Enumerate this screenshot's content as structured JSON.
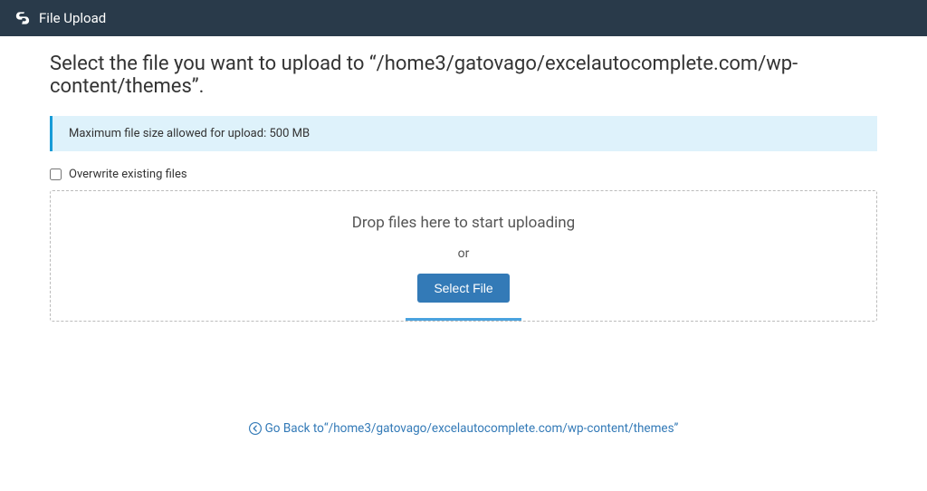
{
  "header": {
    "title": "File Upload"
  },
  "page": {
    "title_prefix": "Select the file you want to upload to ",
    "title_path": "“/home3/gatovago/excelautocomplete.com/wp-content/themes”."
  },
  "notice": {
    "text": "Maximum file size allowed for upload: 500 MB"
  },
  "overwrite": {
    "label": "Overwrite existing files"
  },
  "dropzone": {
    "drop_text": "Drop files here to start uploading",
    "or_text": "or",
    "select_button": "Select File"
  },
  "goback": {
    "prefix": "Go Back to ",
    "path": "“/home3/gatovago/excelautocomplete.com/wp-content/themes”"
  }
}
